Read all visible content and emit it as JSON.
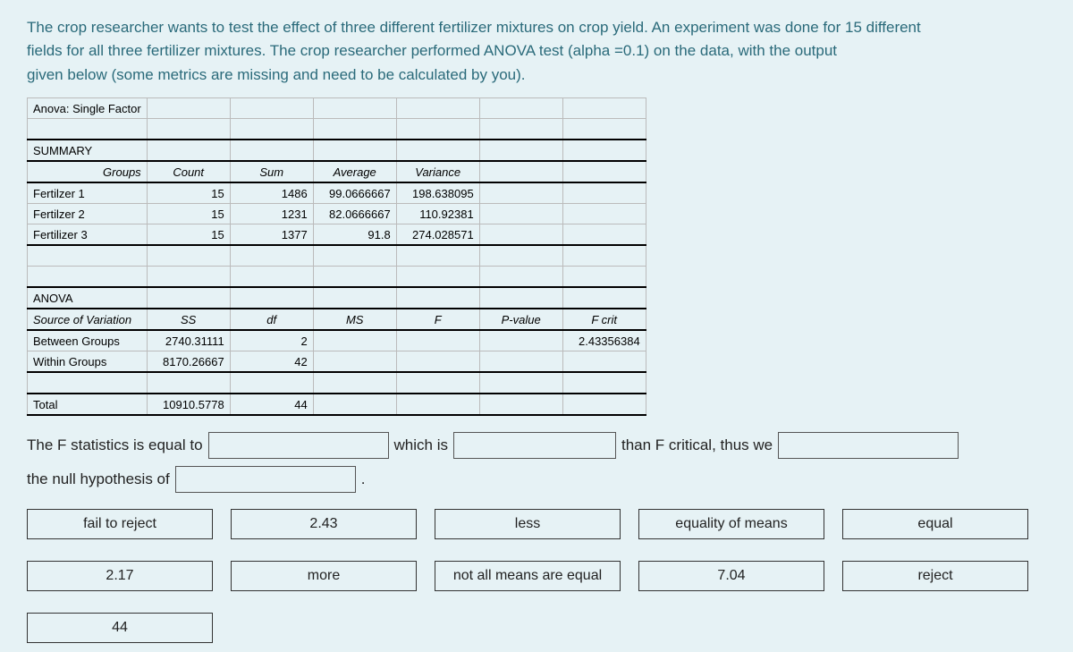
{
  "intro": {
    "l1": "The  crop researcher wants to test the effect of three different fertilizer mixtures on crop yield. An experiment was done for 15 different",
    "l2": "fields for all three fertilizer mixtures. The crop researcher performed ANOVA test (alpha =0.1) on the data, with the output",
    "l3": "given below (some metrics are missing and need to be calculated by you)."
  },
  "sheet": {
    "title": "Anova: Single Factor",
    "summary_label": "SUMMARY",
    "summary_headers": {
      "c0": "Groups",
      "c1": "Count",
      "c2": "Sum",
      "c3": "Average",
      "c4": "Variance"
    },
    "rows": [
      {
        "g": "Fertilzer 1",
        "count": "15",
        "sum": "1486",
        "avg": "99.0666667",
        "var": "198.638095"
      },
      {
        "g": "Fertilzer 2",
        "count": "15",
        "sum": "1231",
        "avg": "82.0666667",
        "var": "110.92381"
      },
      {
        "g": "Fertilizer 3",
        "count": "15",
        "sum": "1377",
        "avg": "91.8",
        "var": "274.028571"
      }
    ],
    "anova_label": "ANOVA",
    "anova_headers": {
      "c0": "Source of Variation",
      "c1": "SS",
      "c2": "df",
      "c3": "MS",
      "c4": "F",
      "c5": "P-value",
      "c6": "F crit"
    },
    "anova_rows": {
      "between": {
        "label": "Between Groups",
        "ss": "2740.31111",
        "df": "2",
        "ms": "",
        "f": "",
        "p": "",
        "fcrit": "2.43356384"
      },
      "within": {
        "label": "Within Groups",
        "ss": "8170.26667",
        "df": "42",
        "ms": "",
        "f": "",
        "p": "",
        "fcrit": ""
      },
      "total": {
        "label": "Total",
        "ss": "10910.5778",
        "df": "44",
        "ms": "",
        "f": "",
        "p": "",
        "fcrit": ""
      }
    }
  },
  "sentence": {
    "p1": "The F statistics is equal to",
    "p2": "which is",
    "p3": "than F critical, thus we",
    "p4": "the null hypothesis of",
    "p5": "."
  },
  "options": [
    "fail to reject",
    "2.43",
    "less",
    "equality of means",
    "equal",
    "2.17",
    "more",
    "not all means are equal",
    "7.04",
    "reject",
    "44"
  ]
}
